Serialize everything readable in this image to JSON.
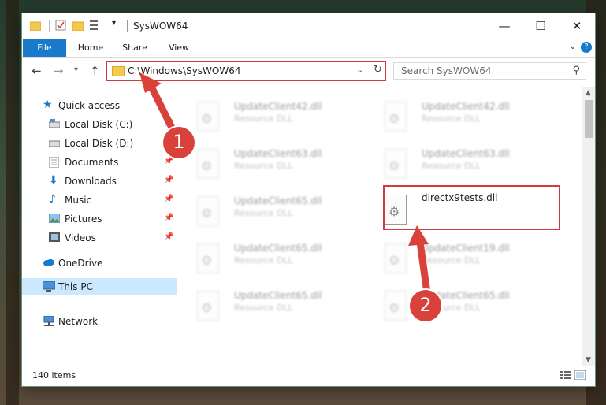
{
  "window": {
    "title": "SysWOW64",
    "controls": {
      "minimize": "—",
      "maximize": "☐",
      "close": "✕"
    }
  },
  "ribbon": {
    "tabs": [
      {
        "label": "File",
        "active": true
      },
      {
        "label": "Home"
      },
      {
        "label": "Share"
      },
      {
        "label": "View"
      }
    ],
    "help": "?"
  },
  "navigation": {
    "address": "C:\\Windows\\SysWOW64",
    "search_placeholder": "Search SysWOW64"
  },
  "sidebar": {
    "items": [
      {
        "label": "Quick access",
        "icon": "star-icon",
        "color": "#1979ca"
      },
      {
        "label": "Local Disk (C:)",
        "icon": "drive-icon",
        "pinned": true
      },
      {
        "label": "Local Disk (D:)",
        "icon": "drive-icon"
      },
      {
        "label": "Documents",
        "icon": "documents-icon",
        "pinned": true
      },
      {
        "label": "Downloads",
        "icon": "downloads-icon",
        "pinned": true
      },
      {
        "label": "Music",
        "icon": "music-icon",
        "pinned": true
      },
      {
        "label": "Pictures",
        "icon": "pictures-icon",
        "pinned": true
      },
      {
        "label": "Videos",
        "icon": "videos-icon",
        "pinned": true
      },
      {
        "label": "OneDrive",
        "icon": "onedrive-icon"
      },
      {
        "label": "This PC",
        "icon": "pc-icon",
        "selected": true
      },
      {
        "label": "Network",
        "icon": "network-icon"
      }
    ]
  },
  "files": [
    {
      "name": "UpdateClient42.dll",
      "desc": "Resource DLL"
    },
    {
      "name": "UpdateClient42.dll",
      "desc": "Resource DLL"
    },
    {
      "name": "UpdateClient63.dll",
      "desc": "Resource DLL"
    },
    {
      "name": "UpdateClient63.dll",
      "desc": "Resource DLL"
    },
    {
      "name": "UpdateClient65.dll",
      "desc": "Resource DLL"
    },
    {
      "name": "directx9tests.dll",
      "desc": "",
      "highlighted": true
    },
    {
      "name": "UpdateClient65.dll",
      "desc": "Resource DLL"
    },
    {
      "name": "UpdateClient19.dll",
      "desc": "Resource DLL"
    },
    {
      "name": "UpdateClient65.dll",
      "desc": "Resource DLL"
    },
    {
      "name": "UpdateClient65.dll",
      "desc": "Resource DLL"
    }
  ],
  "status": {
    "item_count": "140 items"
  },
  "annotations": {
    "step1": "1",
    "step2": "2",
    "color": "#d8423b"
  }
}
